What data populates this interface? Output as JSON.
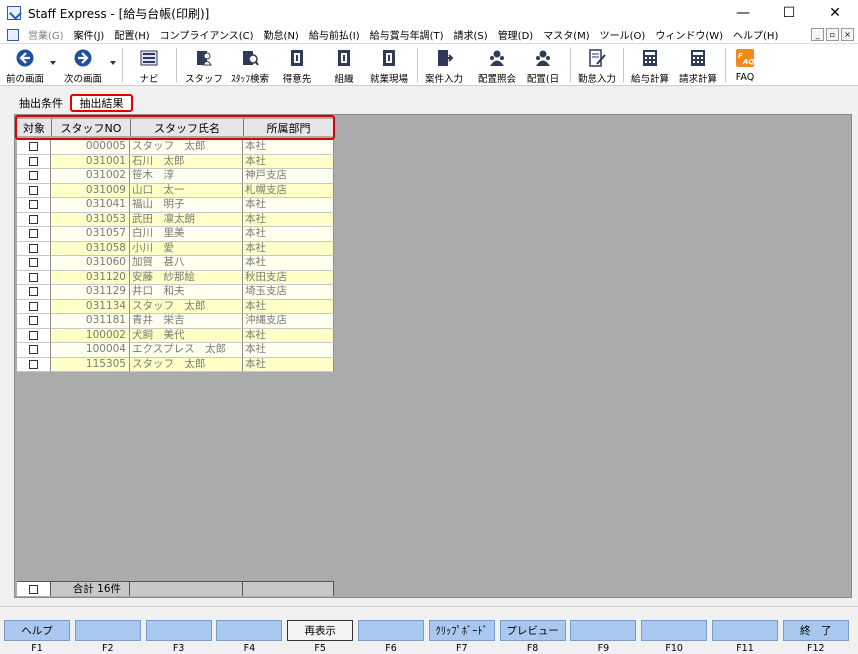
{
  "window": {
    "title": "Staff Express - [給与台帳(印刷)]",
    "minimize": "—",
    "maximize": "☐",
    "close": "✕"
  },
  "menu": [
    "営業(G)",
    "案件(J)",
    "配置(H)",
    "コンプライアンス(C)",
    "勤怠(N)",
    "給与前払(I)",
    "給与賞与年調(T)",
    "請求(S)",
    "管理(D)",
    "マスタ(M)",
    "ツール(O)",
    "ウィンドウ(W)",
    "ヘルプ(H)"
  ],
  "mdi": {
    "minimize": "_",
    "restore": "▫",
    "close": "×"
  },
  "toolbar": {
    "prev": "前の画面",
    "next": "次の画面",
    "navi": "ナビ",
    "staff": "スタッフ",
    "staff_search": "ｽﾀｯﾌ検索",
    "client": "得意先",
    "org": "組織",
    "site": "就業現場",
    "case_entry": "案件入力",
    "assign_ref": "配置照会",
    "assign_day": "配置(日",
    "attendance": "勤怠入力",
    "payroll": "給与計算",
    "billing": "請求計算",
    "faq": "FAQ"
  },
  "tabs": {
    "conditions": "抽出条件",
    "results": "抽出結果"
  },
  "table": {
    "headers": [
      "対象",
      "スタッフNO",
      "スタッフ氏名",
      "所属部門"
    ],
    "rows": [
      {
        "no": "000005",
        "name": "スタッフ　太郎",
        "dept": "本社"
      },
      {
        "no": "031001",
        "name": "石川　太郎",
        "dept": "本社"
      },
      {
        "no": "031002",
        "name": "笹木　淳",
        "dept": "神戸支店"
      },
      {
        "no": "031009",
        "name": "山口　太一",
        "dept": "札幌支店"
      },
      {
        "no": "031041",
        "name": "福山　明子",
        "dept": "本社"
      },
      {
        "no": "031053",
        "name": "武田　凛太朗",
        "dept": "本社"
      },
      {
        "no": "031057",
        "name": "白川　里美",
        "dept": "本社"
      },
      {
        "no": "031058",
        "name": "小川　愛",
        "dept": "本社"
      },
      {
        "no": "031060",
        "name": "加賀　甚八",
        "dept": "本社"
      },
      {
        "no": "031120",
        "name": "安藤　紗那絵",
        "dept": "秋田支店"
      },
      {
        "no": "031129",
        "name": "井口　和夫",
        "dept": "埼玉支店"
      },
      {
        "no": "031134",
        "name": "スタッフ　太郎",
        "dept": "本社"
      },
      {
        "no": "031181",
        "name": "青井　栄吉",
        "dept": "沖縄支店"
      },
      {
        "no": "100002",
        "name": "犬飼　美代",
        "dept": "本社"
      },
      {
        "no": "100004",
        "name": "エクスプレス　太郎",
        "dept": "本社"
      },
      {
        "no": "115305",
        "name": "スタッフ　太郎",
        "dept": "本社"
      }
    ],
    "total_label": "合計 16件"
  },
  "fkeys": [
    {
      "label": "ヘルプ",
      "key": "F1"
    },
    {
      "label": "",
      "key": "F2"
    },
    {
      "label": "",
      "key": "F3"
    },
    {
      "label": "",
      "key": "F4"
    },
    {
      "label": "再表示",
      "key": "F5"
    },
    {
      "label": "",
      "key": "F6"
    },
    {
      "label": "ｸﾘｯﾌﾟﾎﾞｰﾄﾞ",
      "key": "F7"
    },
    {
      "label": "プレビュー",
      "key": "F8"
    },
    {
      "label": "",
      "key": "F9"
    },
    {
      "label": "",
      "key": "F10"
    },
    {
      "label": "",
      "key": "F11"
    },
    {
      "label": "終　了",
      "key": "F12"
    }
  ],
  "colors": {
    "accent_red": "#e00000",
    "fkey_blue": "#a8c8f0",
    "row_yellow": "#ffffc8"
  }
}
